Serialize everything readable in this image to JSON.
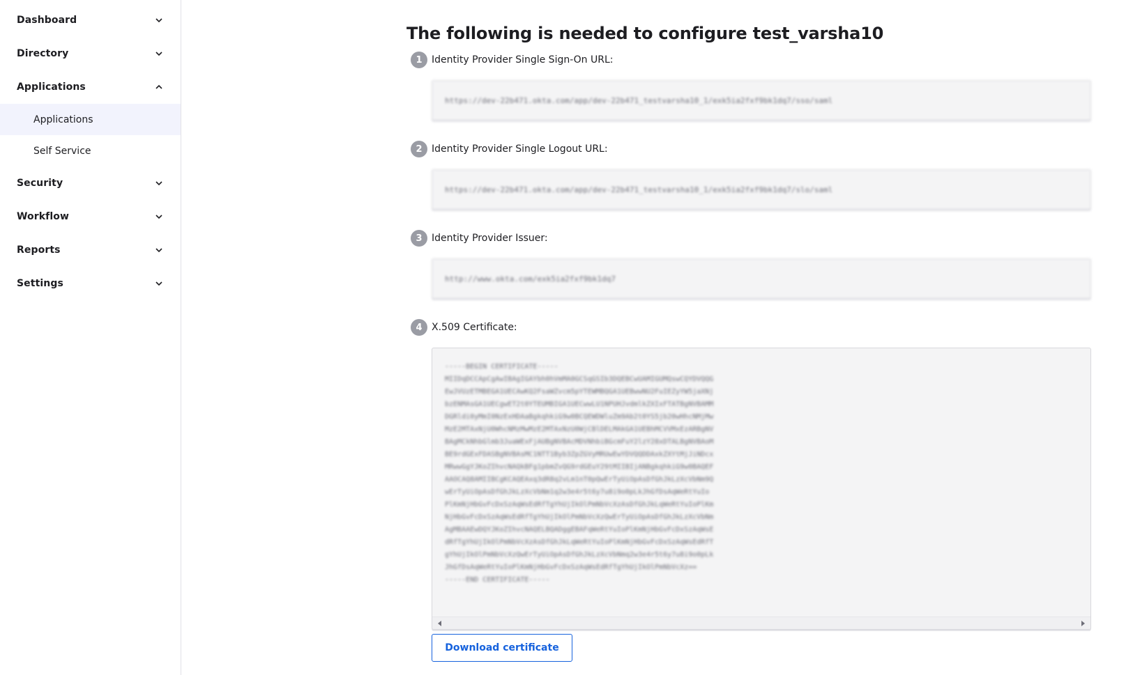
{
  "sidebar": {
    "items": [
      {
        "label": "Dashboard",
        "icon": "chevron-down-icon"
      },
      {
        "label": "Directory",
        "icon": "chevron-down-icon"
      },
      {
        "label": "Applications",
        "icon": "chevron-up-icon",
        "expanded": true,
        "children": [
          {
            "label": "Applications",
            "active": true
          },
          {
            "label": "Self Service"
          }
        ]
      },
      {
        "label": "Security",
        "icon": "chevron-down-icon"
      },
      {
        "label": "Workflow",
        "icon": "chevron-down-icon"
      },
      {
        "label": "Reports",
        "icon": "chevron-down-icon"
      },
      {
        "label": "Settings",
        "icon": "chevron-down-icon"
      }
    ]
  },
  "main": {
    "title": "The following is needed to configure test_varsha10",
    "steps": [
      {
        "num": "1",
        "label": "Identity Provider Single Sign-On URL:"
      },
      {
        "num": "2",
        "label": "Identity Provider Single Logout URL:"
      },
      {
        "num": "3",
        "label": "Identity Provider Issuer:"
      },
      {
        "num": "4",
        "label": "X.509 Certificate:"
      }
    ],
    "download_label": "Download certificate"
  },
  "colors": {
    "accent": "#1662dd",
    "active_nav_bg": "#f2f3fd",
    "step_badge": "#9a9ca4"
  }
}
